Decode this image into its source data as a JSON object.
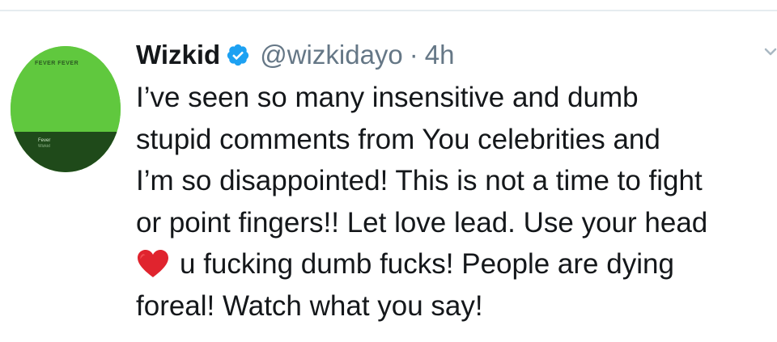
{
  "user": {
    "name": "Wizkid",
    "handle": "@wizkidayo",
    "separator": "·",
    "time": "4h",
    "verified": true,
    "avatar": {
      "art_title": "FEVER FEVER",
      "art_sub": "Fever",
      "art_sub2": "Wizkid"
    }
  },
  "tweet": {
    "lines": [
      "I’ve seen so many insensitive and dumb",
      "stupid comments from You celebrities and",
      "I’m so disappointed! This is not a time to fight",
      "or point fingers!! Let love lead. Use your head",
      "u fucking dumb fucks! People are dying",
      "foreal! Watch what you say!"
    ],
    "emoji": "heart-emoji"
  },
  "colors": {
    "text": "#14171a",
    "muted": "#657786",
    "verified": "#1da1f2",
    "heart": "#e0242e",
    "avatar_green": "#60c83e",
    "avatar_dark": "#1f4a1a"
  },
  "icons": {
    "verified": "verified-badge-icon",
    "caret": "chevron-down-icon",
    "heart": "red-heart-emoji"
  }
}
